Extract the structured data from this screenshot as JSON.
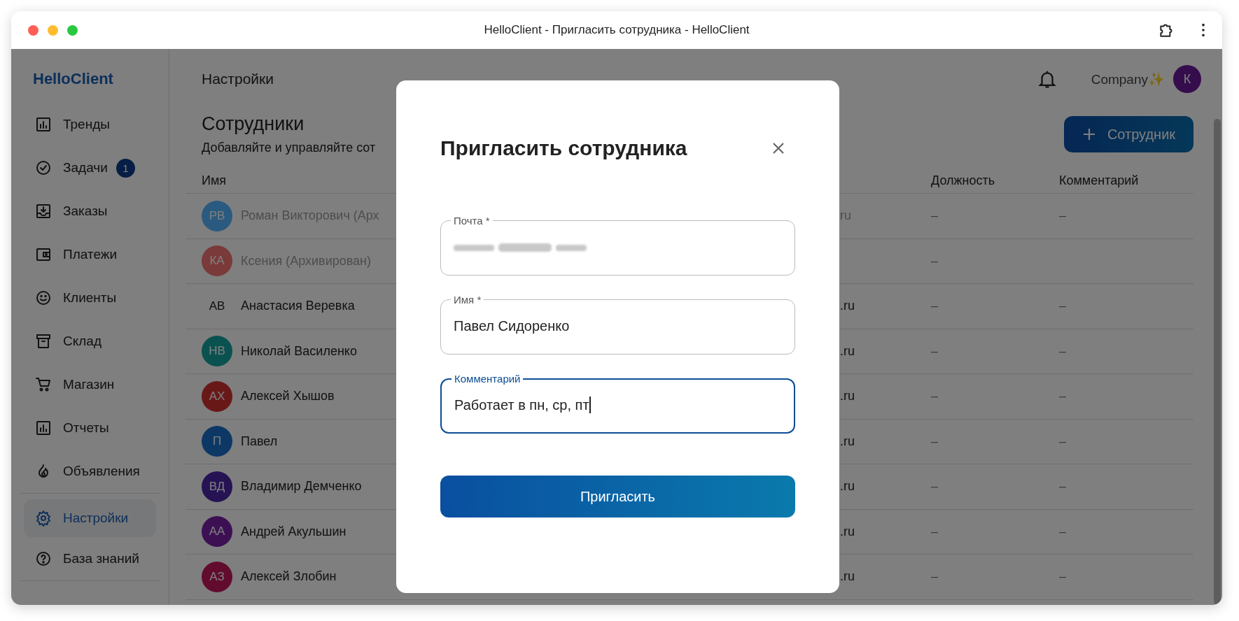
{
  "window": {
    "title": "HelloClient - Пригласить сотрудника - HelloClient"
  },
  "sidebar": {
    "logo": "HelloClient",
    "items": [
      {
        "label": "Тренды",
        "selected": false,
        "divider_before": false
      },
      {
        "label": "Задачи",
        "badge": "1",
        "selected": false,
        "divider_before": false
      },
      {
        "label": "Заказы",
        "selected": false,
        "divider_before": false
      },
      {
        "label": "Платежи",
        "selected": false,
        "divider_before": false
      },
      {
        "label": "Клиенты",
        "selected": false,
        "divider_before": false
      },
      {
        "label": "Склад",
        "selected": false,
        "divider_before": false
      },
      {
        "label": "Магазин",
        "selected": false,
        "divider_before": false
      },
      {
        "label": "Отчеты",
        "selected": false,
        "divider_before": false
      },
      {
        "label": "Объявления",
        "selected": false,
        "divider_before": false
      },
      {
        "label": "Настройки",
        "selected": true,
        "divider_before": true
      },
      {
        "label": "База знаний",
        "selected": false,
        "divider_before": false
      }
    ]
  },
  "header": {
    "title": "Настройки",
    "account": "Company✨",
    "avatar": "К"
  },
  "page": {
    "title": "Сотрудники",
    "subtitle": "Добавляйте и управляйте сот",
    "add_button": "Сотрудник"
  },
  "table": {
    "columns": [
      "Имя",
      "Должность",
      "Комментарий"
    ],
    "rows": [
      {
        "initials": "РВ",
        "color": "#2a5a80",
        "archived": true,
        "name": "Роман Викторович (Арх",
        "column_2": "ru",
        "position": "–",
        "comment": "–"
      },
      {
        "initials": "КА",
        "color": "#7a3a3a",
        "archived": true,
        "name": "Ксения (Архивирован)",
        "position": "–"
      },
      {
        "initials": "АВ",
        "archived": false,
        "name": "Анастасия Веревка",
        "column_2": ".ru",
        "position": "–",
        "comment": "–"
      },
      {
        "initials": "НВ",
        "color": "#0a5250",
        "archived": false,
        "name": "Николай Василенко",
        "column_2": ".ru",
        "position": "–",
        "comment": "–"
      },
      {
        "initials": "АХ",
        "color": "#691818",
        "archived": false,
        "name": "Алексей Хышов",
        "column_2": ".ru",
        "position": "–",
        "comment": "–"
      },
      {
        "initials": "П",
        "color": "#0d3866",
        "archived": false,
        "name": "Павел",
        "column_2": ".ru",
        "position": "–",
        "comment": "–"
      },
      {
        "initials": "ВД",
        "color": "#251354",
        "archived": false,
        "name": "Владимир Демченко",
        "column_2": ".ru",
        "position": "–",
        "comment": "–"
      },
      {
        "initials": "АА",
        "color": "#3d1054",
        "archived": false,
        "name": "Андрей Акульшин",
        "column_2": ".ru",
        "position": "–",
        "comment": "–"
      },
      {
        "initials": "АЗ",
        "color": "#610c2e",
        "archived": false,
        "name": "Алексей Злобин",
        "column_2": ".ru",
        "position": "–",
        "comment": "–"
      }
    ]
  },
  "modal": {
    "title": "Пригласить сотрудника",
    "fields": [
      {
        "label": "Почта *",
        "redacted": true,
        "focused": false
      },
      {
        "label": "Имя *",
        "value": "Павел Сидоренко",
        "redacted": false,
        "focused": false
      },
      {
        "label": "Комментарий",
        "value": "Работает в пн, ср, пт",
        "redacted": false,
        "focused": true
      }
    ],
    "submit": "Пригласить"
  }
}
